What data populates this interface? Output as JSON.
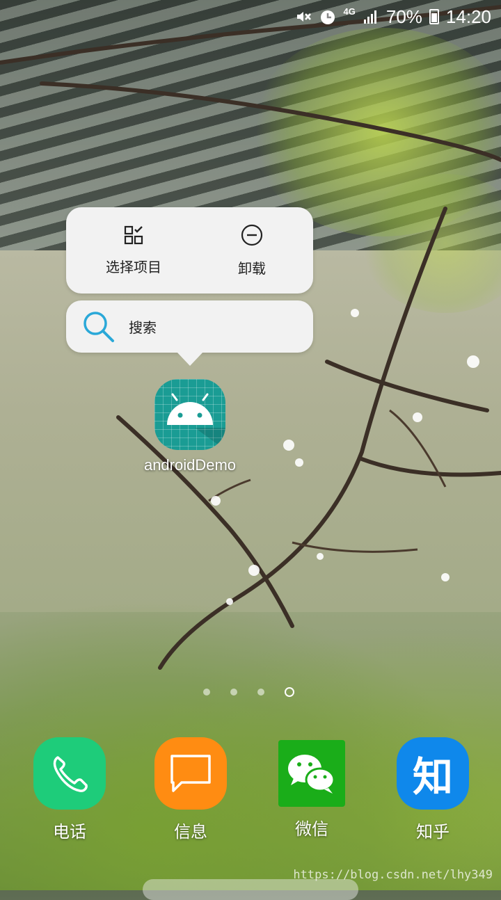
{
  "status_bar": {
    "network": "4G",
    "battery": "70%",
    "time": "14:20",
    "icons": [
      "mute-icon",
      "alarm-icon",
      "signal-icon",
      "battery-icon"
    ]
  },
  "popup": {
    "actions": [
      {
        "label": "选择项目",
        "icon": "select-items-icon"
      },
      {
        "label": "卸载",
        "icon": "uninstall-icon"
      }
    ],
    "search_label": "搜索"
  },
  "app": {
    "label": "androidDemo",
    "icon": "android-icon",
    "color": "#1a9c94"
  },
  "pages": {
    "count": 4,
    "active_index": 3
  },
  "dock": [
    {
      "label": "电话",
      "icon": "phone-icon",
      "color": "#1ecc7a"
    },
    {
      "label": "信息",
      "icon": "message-icon",
      "color": "#ff8c12"
    },
    {
      "label": "微信",
      "icon": "wechat-icon",
      "color": "#1aad19"
    },
    {
      "label": "知乎",
      "icon": "zhihu-icon",
      "color": "#0f88eb",
      "glyph": "知"
    }
  ],
  "watermark": "https://blog.csdn.net/lhy349"
}
